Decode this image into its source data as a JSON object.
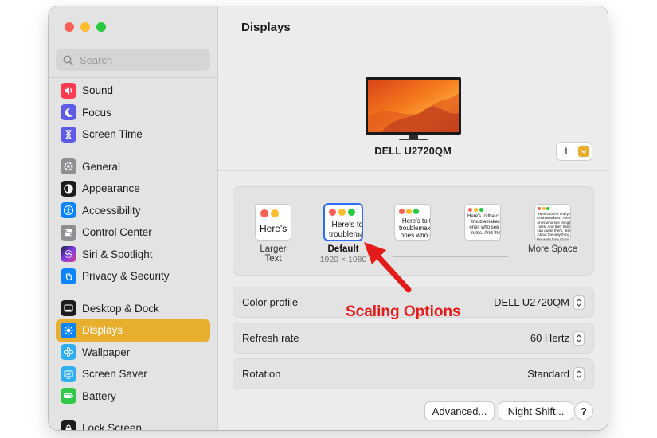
{
  "search": {
    "placeholder": "Search"
  },
  "sidebar": {
    "items": [
      {
        "label": "Sound",
        "icon": "speaker-icon",
        "color": "#ff3b4f"
      },
      {
        "label": "Focus",
        "icon": "moon-icon",
        "color": "#5e5ce6"
      },
      {
        "label": "Screen Time",
        "icon": "hourglass-icon",
        "color": "#5e5ce6"
      },
      {
        "label": "General",
        "icon": "gear-icon",
        "color": "#8e8e93"
      },
      {
        "label": "Appearance",
        "icon": "appearance-icon",
        "color": "#1c1c1e"
      },
      {
        "label": "Accessibility",
        "icon": "accessibility-icon",
        "color": "#0a84ff"
      },
      {
        "label": "Control Center",
        "icon": "switches-icon",
        "color": "#8e8e93"
      },
      {
        "label": "Siri & Spotlight",
        "icon": "siri-icon",
        "color": "#7b3fe4"
      },
      {
        "label": "Privacy & Security",
        "icon": "hand-icon",
        "color": "#0a84ff"
      },
      {
        "label": "Desktop & Dock",
        "icon": "dock-icon",
        "color": "#1c1c1e"
      },
      {
        "label": "Displays",
        "icon": "sun-icon",
        "color": "#0a84ff",
        "active": true
      },
      {
        "label": "Wallpaper",
        "icon": "flower-icon",
        "color": "#30b0f0"
      },
      {
        "label": "Screen Saver",
        "icon": "screensaver-icon",
        "color": "#30b0f0"
      },
      {
        "label": "Battery",
        "icon": "battery-icon",
        "color": "#30c84a"
      },
      {
        "label": "Lock Screen",
        "icon": "lock-icon",
        "color": "#1c1c1e"
      }
    ]
  },
  "main": {
    "title": "Displays",
    "display_name": "DELL U2720QM",
    "add_label": "+"
  },
  "scaling": {
    "options": [
      {
        "label": "Larger Text",
        "sample": "Here's"
      },
      {
        "label": "Default",
        "resolution": "1920 × 1080",
        "sample": "Here's to the\ntroublemakers",
        "selected": true
      },
      {
        "label": "",
        "sample": "Here's to the\ntroublemakers.\nones who see"
      },
      {
        "label": "",
        "sample": "Here's to the crazy\ntroublemakers.\nones who see thi\nrules. And they"
      },
      {
        "label": "More Space",
        "sample": "Here's to the crazy one\ntroublemakers. The roun\nones who see things diff\nrules. And they have no\ncan quote them, disagre\nAbout the only thing you\nBecause they change thi"
      }
    ]
  },
  "settings": {
    "color_profile": {
      "label": "Color profile",
      "value": "DELL U2720QM"
    },
    "refresh_rate": {
      "label": "Refresh rate",
      "value": "60 Hertz"
    },
    "rotation": {
      "label": "Rotation",
      "value": "Standard"
    }
  },
  "buttons": {
    "advanced": "Advanced...",
    "night_shift": "Night Shift...",
    "help": "?"
  },
  "annotation": {
    "text": "Scaling Options",
    "color": "#e31b1b"
  }
}
